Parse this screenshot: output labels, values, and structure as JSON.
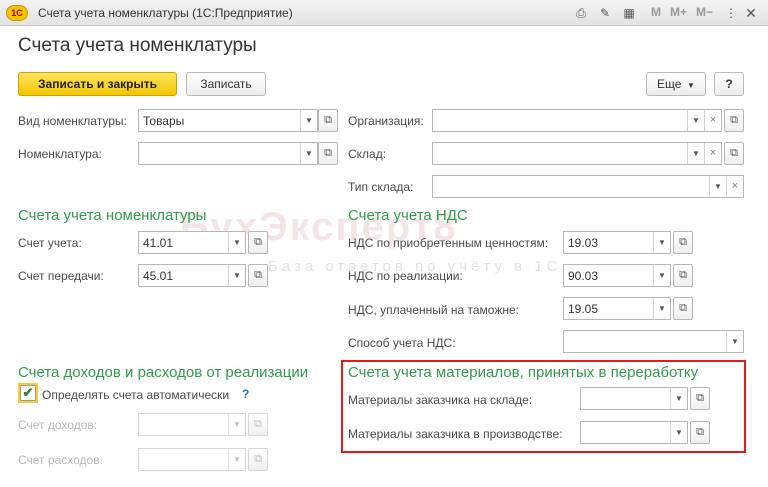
{
  "window": {
    "title": "Счета учета номенклатуры (1С:Предприятие)",
    "logo_text": "1С"
  },
  "titlebar": {
    "m_labels": [
      "M",
      "M+",
      "M−"
    ]
  },
  "form": {
    "title": "Счета учета номенклатуры",
    "toolbar": {
      "save_close": "Записать и закрыть",
      "save": "Записать",
      "more": "Еще",
      "help": "?"
    }
  },
  "left": {
    "kind": {
      "label": "Вид номенклатуры:",
      "value": "Товары"
    },
    "item": {
      "label": "Номенклатура:",
      "value": ""
    },
    "section_accounts": "Счета учета номенклатуры",
    "account": {
      "label": "Счет учета:",
      "value": "41.01"
    },
    "transfer": {
      "label": "Счет передачи:",
      "value": "45.01"
    },
    "section_income": "Счета доходов и расходов от реализации",
    "auto": {
      "label": "Определять счета автоматически",
      "checked": true,
      "help": "?"
    },
    "income": {
      "label": "Счет доходов:",
      "value": ""
    },
    "expense": {
      "label": "Счет расходов:",
      "value": ""
    }
  },
  "right": {
    "org": {
      "label": "Организация:",
      "value": ""
    },
    "warehouse": {
      "label": "Склад:",
      "value": ""
    },
    "warehouse_type": {
      "label": "Тип склада:",
      "value": ""
    },
    "section_vat": "Счета учета НДС",
    "vat_purchased": {
      "label": "НДС по приобретенным ценностям:",
      "value": "19.03"
    },
    "vat_sales": {
      "label": "НДС по реализации:",
      "value": "90.03"
    },
    "vat_customs": {
      "label": "НДС, уплаченный на таможне:",
      "value": "19.05"
    },
    "vat_method": {
      "label": "Способ учета НДС:",
      "value": ""
    },
    "section_materials": "Счета учета материалов, принятых в переработку",
    "mat_warehouse": {
      "label": "Материалы заказчика на складе:",
      "value": ""
    },
    "mat_production": {
      "label": "Материалы заказчика в производстве:",
      "value": ""
    }
  },
  "watermark": {
    "main": "БухЭксперт8",
    "sub": "База ответов по учёту в 1С"
  }
}
